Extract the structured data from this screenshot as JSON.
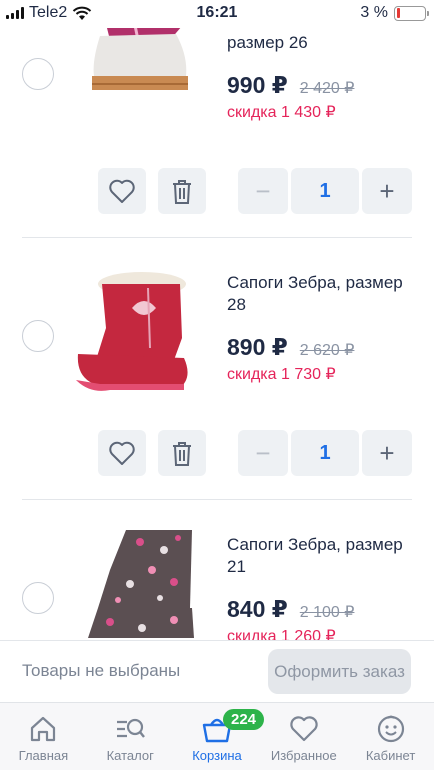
{
  "status_bar": {
    "carrier": "Tele2",
    "time": "16:21",
    "battery": "3 %"
  },
  "items": [
    {
      "title": "размер 26",
      "price": "990 ₽",
      "old_price": "2 420 ₽",
      "discount": "скидка 1 430 ₽",
      "quantity": "1"
    },
    {
      "title": "Сапоги Зебра, размер 28",
      "price": "890 ₽",
      "old_price": "2 620 ₽",
      "discount": "скидка 1 730 ₽",
      "quantity": "1"
    },
    {
      "title": "Сапоги Зебра, размер 21",
      "price": "840 ₽",
      "old_price": "2 100 ₽",
      "discount": "скидка 1 260 ₽"
    }
  ],
  "stepper": {
    "minus": "−",
    "plus": "+"
  },
  "checkout": {
    "status": "Товары не выбраны",
    "button": "Оформить заказ"
  },
  "nav": [
    {
      "label": "Главная",
      "icon": "home-icon"
    },
    {
      "label": "Каталог",
      "icon": "catalog-search-icon"
    },
    {
      "label": "Корзина",
      "icon": "basket-icon",
      "badge": "224",
      "active": true
    },
    {
      "label": "Избранное",
      "icon": "heart-icon"
    },
    {
      "label": "Кабинет",
      "icon": "smiley-icon"
    }
  ],
  "colors": {
    "accent": "#1f6fe5",
    "discount": "#e5245a",
    "badge": "#2db34a",
    "price": "#1f2a44"
  }
}
